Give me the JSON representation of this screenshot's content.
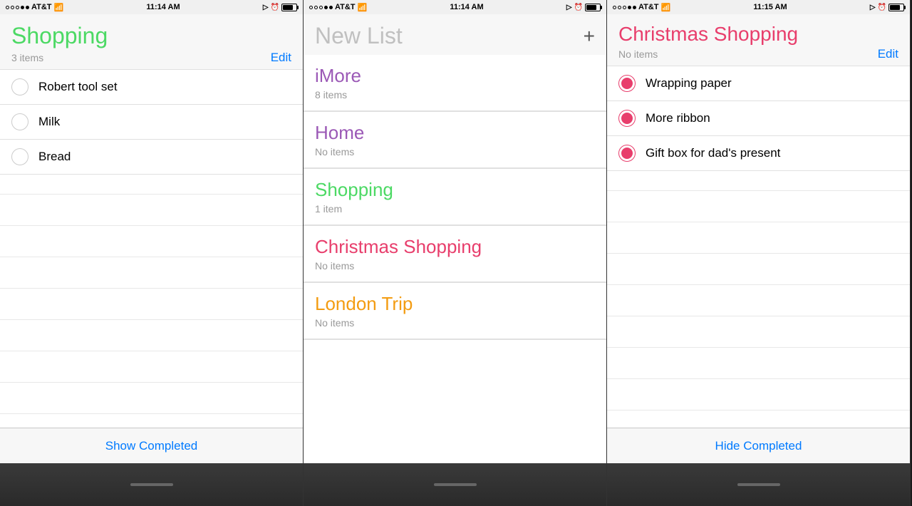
{
  "panel1": {
    "status": {
      "carrier": "AT&T",
      "time": "11:14 AM",
      "wifi": true
    },
    "title": "Shopping",
    "subtitle": "3 items",
    "edit_label": "Edit",
    "items": [
      {
        "text": "Robert tool set",
        "checked": false
      },
      {
        "text": "Milk",
        "checked": false
      },
      {
        "text": "Bread",
        "checked": false
      }
    ],
    "bottom_btn": "Show Completed",
    "title_color": "#4cd964"
  },
  "panel2": {
    "status": {
      "carrier": "AT&T",
      "time": "11:14 AM",
      "wifi": true
    },
    "new_list_placeholder": "New List",
    "plus_icon": "+",
    "lists": [
      {
        "name": "iMore",
        "count": "8 items",
        "color": "#9b59b6"
      },
      {
        "name": "Home",
        "count": "No items",
        "color": "#9b59b6"
      },
      {
        "name": "Shopping",
        "count": "1 item",
        "color": "#4cd964"
      },
      {
        "name": "Christmas Shopping",
        "count": "No items",
        "color": "#e83e6c"
      },
      {
        "name": "London Trip",
        "count": "No items",
        "color": "#f39c12"
      }
    ]
  },
  "panel3": {
    "status": {
      "carrier": "AT&T",
      "time": "11:15 AM",
      "wifi": true
    },
    "title": "Christmas Shopping",
    "subtitle": "No items",
    "edit_label": "Edit",
    "items": [
      {
        "text": "Wrapping paper",
        "checked": true
      },
      {
        "text": "More ribbon",
        "checked": true
      },
      {
        "text": "Gift box for dad's present",
        "checked": true
      }
    ],
    "bottom_btn": "Hide Completed",
    "title_color": "#e83e6c"
  }
}
